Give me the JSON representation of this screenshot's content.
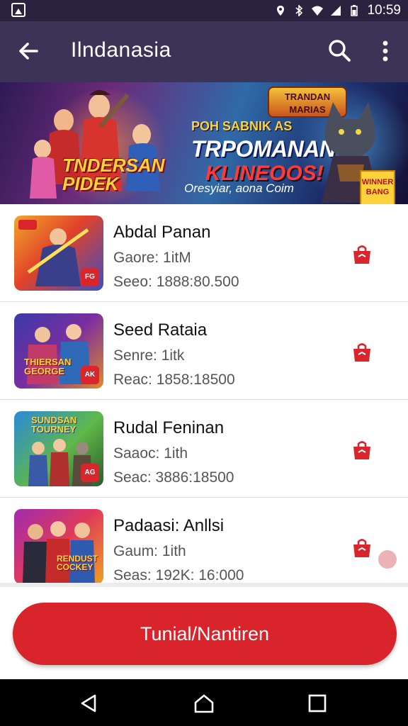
{
  "status_bar": {
    "time": "10:59",
    "icons": [
      "gallery-icon",
      "location-icon",
      "bluetooth-icon",
      "wifi-icon",
      "signal-icon",
      "battery-icon"
    ]
  },
  "app_bar": {
    "title": "Ilndanasia",
    "icons": [
      "back-arrow-icon",
      "search-icon",
      "more-vert-icon"
    ]
  },
  "banner": {
    "badge_top": "TRANDAN\nMARIAS",
    "line1": "POH SABNIK AS",
    "line2": "TRPOMANAN",
    "line3": "KLINEOOS!",
    "left_title": "TNDERSAN\nPIDEK",
    "caption": "Oresyiar, aona Coim",
    "corner_tag": "WINNER\nBANG"
  },
  "games": [
    {
      "name": "Abdal Panan",
      "meta1": "Gaore: 1itM",
      "meta2": "Seeo: 1888:80.500",
      "thumb_tag": "FG"
    },
    {
      "name": "Seed Rataia",
      "meta1": "Senre: 1itk",
      "meta2": "Reac: 1858:18500",
      "thumb_tag": "AK",
      "thumb_label": "THIERSAN\nGEORGE"
    },
    {
      "name": "Rudal Feninan",
      "meta1": "Saaoc: 1ith",
      "meta2": "Seac: 3886:18500",
      "thumb_tag": "AG",
      "thumb_label": "SUNDSAN\nTOURNEY"
    },
    {
      "name": "Padaasi: Anllsi",
      "meta1": "Gaum: 1ith",
      "meta2": "Seas: 192K: 16:000",
      "thumb_label": "RENDUST\nCOCKEY"
    }
  ],
  "cta": {
    "label": "Tunial/Nantiren"
  },
  "colors": {
    "app_bar": "#3b3456",
    "status_bar": "#2a2340",
    "accent_red": "#d8242a"
  },
  "nav_bar": {
    "icons": [
      "nav-back-icon",
      "nav-home-icon",
      "nav-recents-icon"
    ]
  }
}
